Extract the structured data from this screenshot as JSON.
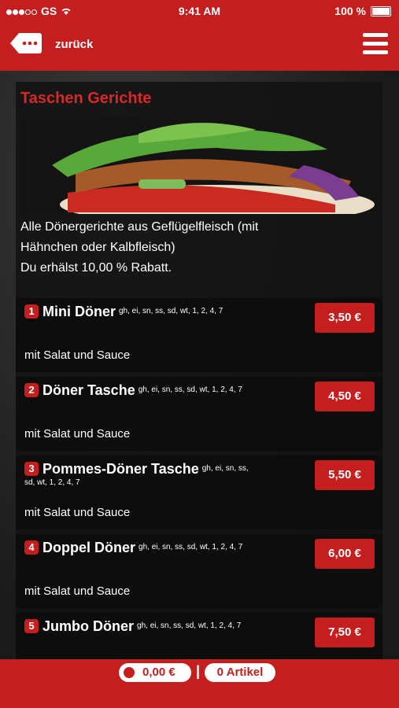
{
  "status": {
    "carrier": "GS",
    "time": "9:41 AM",
    "battery": "100 %"
  },
  "header": {
    "back_label": "zurück"
  },
  "section": {
    "title": "Taschen Gerichte",
    "description_lines": [
      "Alle Dönergerichte aus Geflügelfleisch (mit",
      "Hähnchen oder Kalbfleisch)",
      "Du erhälst 10,00 % Rabatt."
    ]
  },
  "items": [
    {
      "num": "1",
      "name": "Mini Döner",
      "allergens": "gh, ei, sn, ss, sd, wt, 1, 2, 4, 7",
      "sub": "mit Salat und Sauce",
      "price": "3,50 €"
    },
    {
      "num": "2",
      "name": "Döner Tasche",
      "allergens": "gh, ei, sn, ss, sd, wt, 1, 2, 4, 7",
      "sub": "mit Salat und Sauce",
      "price": "4,50 €"
    },
    {
      "num": "3",
      "name": "Pommes-Döner Tasche",
      "allergens": "gh, ei, sn, ss, sd, wt, 1, 2, 4, 7",
      "sub": "mit Salat und Sauce",
      "price": "5,50 €"
    },
    {
      "num": "4",
      "name": "Doppel Döner",
      "allergens": "gh, ei, sn, ss, sd, wt, 1, 2, 4, 7",
      "sub": "mit Salat und Sauce",
      "price": "6,00 €"
    },
    {
      "num": "5",
      "name": "Jumbo Döner",
      "allergens": "gh, ei, sn, ss, sd, wt, 1, 2, 4, 7",
      "sub": "",
      "price": "7,50 €"
    }
  ],
  "footer": {
    "cart_total": "0,00 €",
    "separator": "|",
    "article_count": "0 Artikel"
  },
  "colors": {
    "brand_red": "#c41e1e",
    "title_red": "#d42a2a"
  }
}
